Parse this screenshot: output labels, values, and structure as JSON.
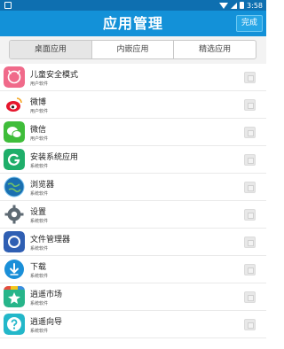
{
  "status_bar": {
    "time": "3:58"
  },
  "header": {
    "title": "应用管理",
    "done_label": "完成"
  },
  "tabs": [
    {
      "label": "桌面应用",
      "active": true
    },
    {
      "label": "内嵌应用",
      "active": false
    },
    {
      "label": "精选应用",
      "active": false
    }
  ],
  "apps": [
    {
      "name": "儿童安全模式",
      "type": "用户软件",
      "icon": "children-mode-icon"
    },
    {
      "name": "微博",
      "type": "用户软件",
      "icon": "weibo-icon"
    },
    {
      "name": "微信",
      "type": "用户软件",
      "icon": "wechat-icon"
    },
    {
      "name": "安装系统应用",
      "type": "系统软件",
      "icon": "install-system-app-icon"
    },
    {
      "name": "浏览器",
      "type": "系统软件",
      "icon": "browser-globe-icon"
    },
    {
      "name": "设置",
      "type": "系统软件",
      "icon": "settings-gear-icon"
    },
    {
      "name": "文件管理器",
      "type": "系统软件",
      "icon": "file-manager-icon"
    },
    {
      "name": "下载",
      "type": "系统软件",
      "icon": "download-icon"
    },
    {
      "name": "逍遥市场",
      "type": "系统软件",
      "icon": "app-market-icon"
    },
    {
      "name": "逍遥向导",
      "type": "系统软件",
      "icon": "guide-help-icon"
    }
  ],
  "colors": {
    "title_bar": "#1391d8",
    "status_bar": "#0e6fb0",
    "done_button": "#26a6e6"
  }
}
